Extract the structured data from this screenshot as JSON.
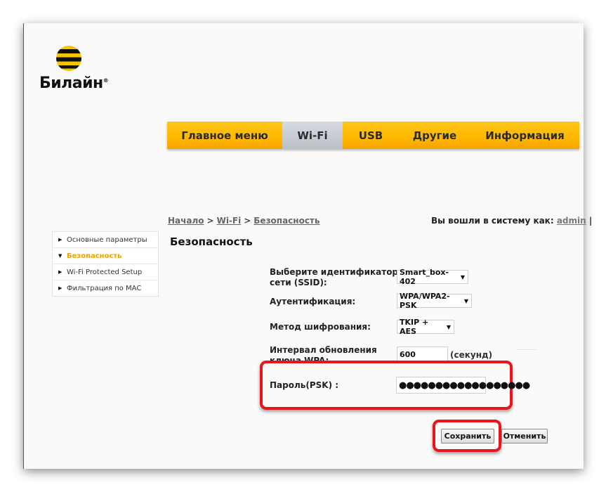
{
  "brand": {
    "name": "Билайн",
    "registered_mark": "®"
  },
  "nav": {
    "tabs": [
      {
        "label": "Главное меню",
        "active": false
      },
      {
        "label": "Wi-Fi",
        "active": true
      },
      {
        "label": "USB",
        "active": false
      },
      {
        "label": "Другие",
        "active": false
      },
      {
        "label": "Информация",
        "active": false
      }
    ]
  },
  "breadcrumb": {
    "items": [
      "Начало",
      "Wi-Fi",
      "Безопасность"
    ],
    "separator": ">"
  },
  "login": {
    "prefix": "Вы вошли в систему как:",
    "user": "admin",
    "divider": "|"
  },
  "page": {
    "title": "Безопасность"
  },
  "sidebar": {
    "items": [
      {
        "label": "Основные параметры",
        "active": false
      },
      {
        "label": "Безопасность",
        "active": true
      },
      {
        "label": "Wi-Fi Protected Setup",
        "active": false
      },
      {
        "label": "Фильтрация по MAC",
        "active": false
      }
    ]
  },
  "form": {
    "ssid": {
      "label_line1": "Выберите идентификатор",
      "label_line2": "сети (SSID):",
      "value": "Smart_box-402"
    },
    "auth": {
      "label": "Аутентификация:",
      "value": "WPA/WPA2-PSK"
    },
    "encryption": {
      "label": "Метод шифрования:",
      "value": "TKIP + AES"
    },
    "interval": {
      "label_line1": "Интервал обновления",
      "label_line2": "ключа WPA:",
      "value": "600",
      "unit": "(секунд)"
    },
    "password": {
      "label": "Пароль(PSK) :",
      "value": "●●●●●●●●●●●●●●●●●●"
    }
  },
  "buttons": {
    "save": "Сохранить",
    "cancel": "Отменить"
  },
  "colors": {
    "brand_yellow": "#ffb800",
    "highlight_red": "#e8161c",
    "active_sidebar": "#f0a000"
  }
}
